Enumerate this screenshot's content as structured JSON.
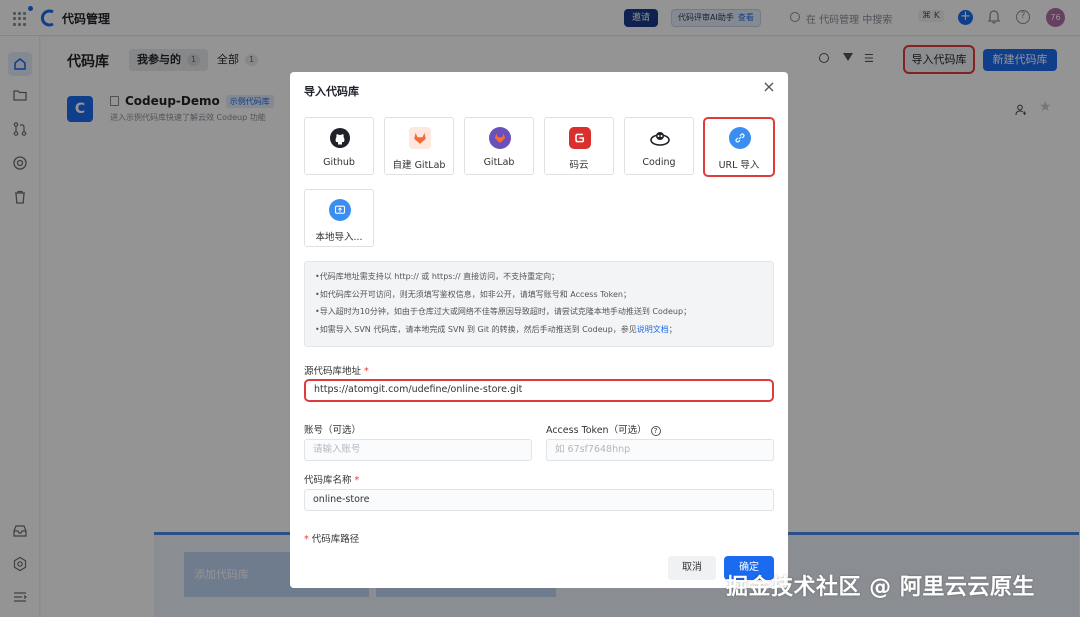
{
  "topbar": {
    "app_name": "代码管理",
    "invite_label": "邀请",
    "ai_prompt": "代码评审AI助手",
    "ai_link": "查看",
    "search_placeholder": "在 代码管理 中搜索",
    "shortcut": "⌘ K",
    "avatar_text": "76",
    "help_glyph": "?"
  },
  "page": {
    "title": "代码库",
    "tabs": [
      {
        "label": "我参与的",
        "count": "1"
      },
      {
        "label": "全部",
        "count": "1"
      }
    ],
    "sort_glyph": "☰",
    "import_button": "导入代码库",
    "new_button": "新建代码库",
    "repo": {
      "logo_letter": "C",
      "name": "Codeup-Demo",
      "badge": "示例代码库",
      "description": "进入示例代码库快速了解云效 Codeup 功能"
    },
    "bg_card_button": "添加代码库"
  },
  "modal": {
    "title": "导入代码库",
    "close_glyph": "×",
    "sources": [
      {
        "label": "Github",
        "icon": "github-icon"
      },
      {
        "label": "自建 GitLab",
        "icon": "gitlab-fox-icon"
      },
      {
        "label": "GitLab",
        "icon": "gitlab-icon"
      },
      {
        "label": "码云",
        "icon": "gitee-icon"
      },
      {
        "label": "Coding",
        "icon": "coding-icon"
      },
      {
        "label": "URL 导入",
        "icon": "link-icon"
      },
      {
        "label": "本地导入...",
        "icon": "local-upload-icon"
      }
    ],
    "selected_source": "URL 导入",
    "notes": [
      "•代码库地址需支持以 http:// 或 https:// 直接访问，不支持重定向；",
      "•如代码库公开可访问，则无须填写鉴权信息，如非公开，请填写账号和 Access Token；",
      "•导入超时为10分钟，如由于仓库过大或网络不佳等原因导致超时，请尝试克隆本地手动推送到 Codeup；",
      "•如需导入 SVN 代码库，请本地完成 SVN 到 Git 的转换，然后手动推送到 Codeup，参见"
    ],
    "doc_link": "说明文档",
    "doc_link_suffix": "；",
    "source_url_label": "源代码库地址",
    "source_url_value": "https://atomgit.com/udefine/online-store.git",
    "account_label": "账号（可选）",
    "account_placeholder": "请输入账号",
    "token_label": "Access Token（可选）",
    "token_placeholder": "如 67sf7648hnp",
    "repo_name_label": "代码库名称",
    "repo_name_value": "online-store",
    "repo_path_label": "代码库路径",
    "required_mark": "*",
    "cancel_button": "取消",
    "ok_button": "确定"
  },
  "watermark": "掘金技术社区 @ 阿里云云原生",
  "colors": {
    "primary": "#1b6bf0",
    "highlight_border": "#e03b3b",
    "overlay": "rgba(0,0,0,0.42)"
  }
}
